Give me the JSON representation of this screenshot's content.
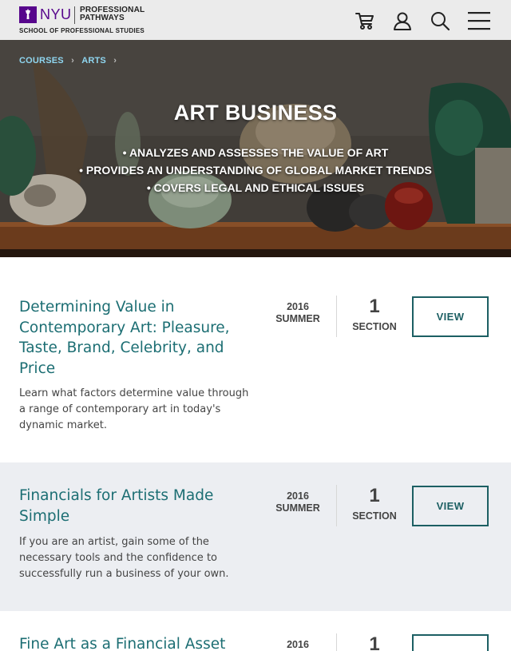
{
  "header": {
    "logo_university": "NYU",
    "logo_program_line1": "PROFESSIONAL",
    "logo_program_line2": "PATHWAYS",
    "logo_school": "SCHOOL OF PROFESSIONAL STUDIES",
    "icons": [
      "torch-logo-icon",
      "cart-icon",
      "user-icon",
      "search-icon",
      "menu-icon"
    ],
    "brand_color": "#57068c"
  },
  "breadcrumb": {
    "items": [
      "COURSES",
      "ARTS"
    ],
    "separator": "›"
  },
  "hero": {
    "title": "ART BUSINESS",
    "bullets": [
      "• ANALYZES AND ASSESSES THE VALUE OF ART",
      "• PROVIDES AN UNDERSTANDING OF GLOBAL MARKET TRENDS",
      "• COVERS LEGAL AND ETHICAL ISSUES"
    ]
  },
  "courses": [
    {
      "title": "Determining Value in Contemporary Art: Pleasure, Taste, Brand, Celebrity, and Price",
      "description": "Learn what factors determine value through a range of contemporary art in today's dynamic market.",
      "year": "2016",
      "term": "SUMMER",
      "sections": "1",
      "sections_label": "SECTION",
      "button": "VIEW"
    },
    {
      "title": "Financials for Artists Made Simple",
      "description": "If you are an artist, gain some of the necessary tools and the confidence to successfully run a business of your own.",
      "year": "2016",
      "term": "SUMMER",
      "sections": "1",
      "sections_label": "SECTION",
      "button": "VIEW"
    },
    {
      "title": "Fine Art as a Financial Asset",
      "year": "2016",
      "sections": "1"
    }
  ],
  "colors": {
    "accent_teal": "#1c6e73",
    "alt_row_bg": "#eceef2",
    "breadcrumb": "#8fd6f0"
  }
}
